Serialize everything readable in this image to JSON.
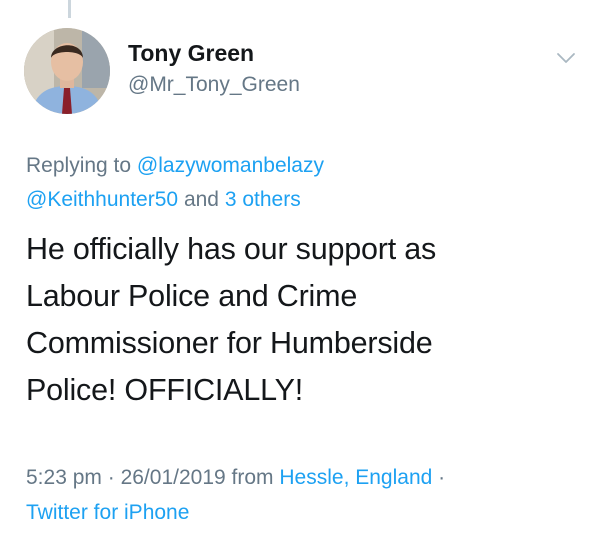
{
  "tweet": {
    "author": {
      "name": "Tony Green",
      "handle": "@Mr_Tony_Green"
    },
    "reply": {
      "prefix": "Replying to",
      "mention1": "@lazywomanbelazy",
      "mention2": "@Keithhunter50",
      "and_text": "and",
      "others_link": "3 others"
    },
    "text_lines": [
      "He officially has our support as",
      "Labour Police and Crime",
      "Commissioner for Humberside",
      "Police! OFFICIALLY!"
    ],
    "meta": {
      "time": "5:23 pm",
      "date": "26/01/2019",
      "separator": "·",
      "from_text": "from",
      "location": "Hessle, England",
      "source": "Twitter for iPhone"
    },
    "colors": {
      "link": "#1da1f2",
      "secondary_text": "#657786",
      "primary_text": "#14171a"
    },
    "icons": {
      "menu_caret": "chevron-down-icon"
    }
  }
}
